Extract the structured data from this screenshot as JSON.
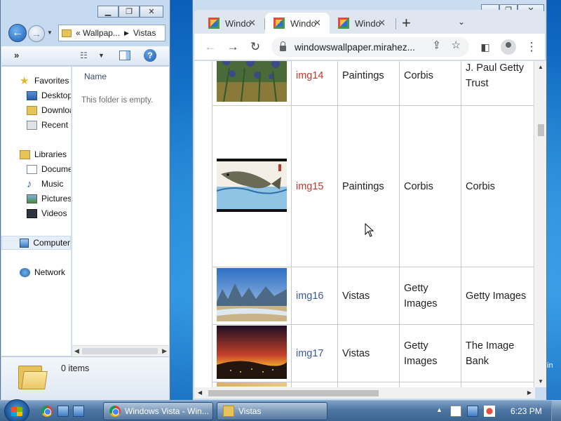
{
  "desktop": {
    "side_text": "in"
  },
  "explorer": {
    "breadcrumb": {
      "chevrons": "«",
      "parent": "Wallpap...",
      "current": "Vistas"
    },
    "toolbar": {
      "more": "»"
    },
    "nav": {
      "favorites": "Favorites",
      "desktop": "Desktop",
      "downloads": "Downloads",
      "recent": "Recent Places",
      "libraries": "Libraries",
      "documents": "Documents",
      "music": "Music",
      "pictures": "Pictures",
      "videos": "Videos",
      "computer": "Computer",
      "network": "Network"
    },
    "content": {
      "column_name": "Name",
      "empty_message": "This folder is empty."
    },
    "details": {
      "items_count": "0 items"
    }
  },
  "browser": {
    "tabs": [
      {
        "label": "Windo",
        "active": false
      },
      {
        "label": "Windo",
        "active": true
      },
      {
        "label": "Windo",
        "active": false
      }
    ],
    "url": "windowswallpaper.mirahez...",
    "table": {
      "rows": [
        {
          "thumb": "irises-painting",
          "id": "img14",
          "category": "Paintings",
          "source": "Corbis",
          "owner": "J. Paul Getty Trust"
        },
        {
          "thumb": "koi-fish-painting",
          "id": "img15",
          "category": "Paintings",
          "source": "Corbis",
          "owner": "Corbis"
        },
        {
          "thumb": "karst-river-landscape",
          "id": "img16",
          "category": "Vistas",
          "source": "Getty Images",
          "owner": "Getty Images"
        },
        {
          "thumb": "sunset-city",
          "id": "img17",
          "category": "Vistas",
          "source": "Getty Images",
          "owner": "The Image Bank"
        }
      ]
    }
  },
  "taskbar": {
    "buttons": [
      {
        "label": "Windows Vista - Win...",
        "icon": "chrome-icon"
      },
      {
        "label": "Vistas",
        "icon": "folder-icon"
      }
    ],
    "clock": "6:23 PM"
  }
}
